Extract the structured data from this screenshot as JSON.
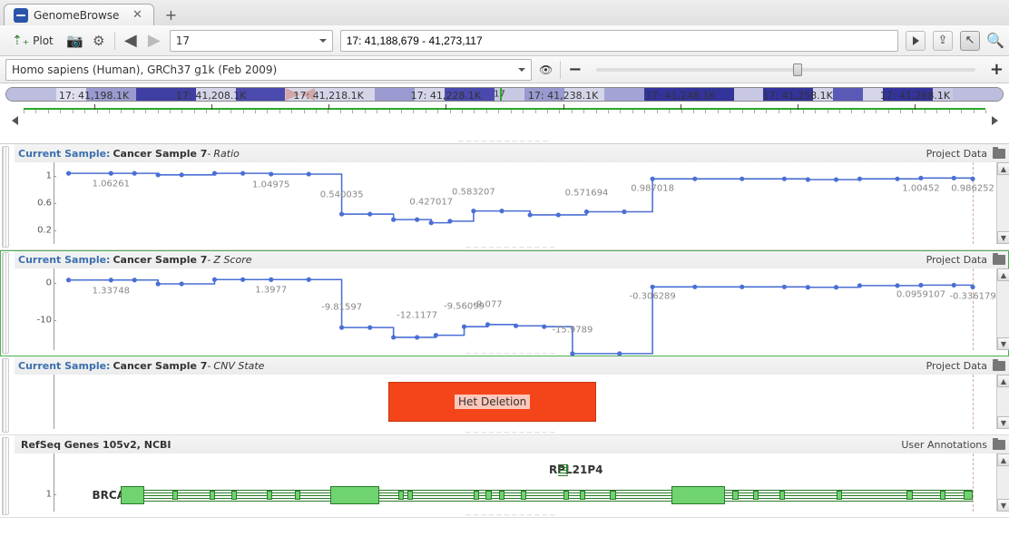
{
  "tab": {
    "title": "GenomeBrowse"
  },
  "toolbar": {
    "plot_label": "Plot",
    "chrom": "17",
    "location": "17: 41,188,679 - 41,273,117"
  },
  "species": {
    "label": "Homo sapiens (Human), GRCh37 g1k (Feb 2009)",
    "zoom_pos": 0.52
  },
  "ruler": {
    "ticks": [
      "17: 41,198.1K",
      "17: 41,208.1K",
      "17: 41,218.1K",
      "17: 41,228.1K",
      "17: 41,238.1K",
      "17: 41,248.1K",
      "17: 41,258.1K",
      "17: 41,268.1K"
    ]
  },
  "tracks": [
    {
      "id": "ratio",
      "prefix": "Current Sample:",
      "sample": "Cancer Sample 7",
      "metric": "Ratio",
      "right": "Project Data",
      "yticks": [
        "1",
        "0.6",
        "0.2"
      ],
      "points": [
        {
          "x": 0.015,
          "y": 1.06
        },
        {
          "x": 0.06,
          "y": 1.06,
          "l": "1.06261"
        },
        {
          "x": 0.085,
          "y": 1.06
        },
        {
          "x": 0.11,
          "y": 1.04
        },
        {
          "x": 0.135,
          "y": 1.04
        },
        {
          "x": 0.17,
          "y": 1.06
        },
        {
          "x": 0.2,
          "y": 1.06
        },
        {
          "x": 0.23,
          "y": 1.05,
          "l": "1.04975"
        },
        {
          "x": 0.27,
          "y": 1.05
        },
        {
          "x": 0.305,
          "y": 0.54,
          "l": "0.540035"
        },
        {
          "x": 0.335,
          "y": 0.54
        },
        {
          "x": 0.36,
          "y": 0.47
        },
        {
          "x": 0.385,
          "y": 0.47
        },
        {
          "x": 0.4,
          "y": 0.43,
          "l": "0.427017"
        },
        {
          "x": 0.42,
          "y": 0.45
        },
        {
          "x": 0.445,
          "y": 0.58,
          "l": "0.583207"
        },
        {
          "x": 0.475,
          "y": 0.58
        },
        {
          "x": 0.505,
          "y": 0.53
        },
        {
          "x": 0.535,
          "y": 0.53
        },
        {
          "x": 0.565,
          "y": 0.57,
          "l": "0.571694"
        },
        {
          "x": 0.605,
          "y": 0.57
        },
        {
          "x": 0.635,
          "y": 0.99,
          "l": "0.987018"
        },
        {
          "x": 0.68,
          "y": 0.99
        },
        {
          "x": 0.73,
          "y": 0.99
        },
        {
          "x": 0.775,
          "y": 0.99
        },
        {
          "x": 0.8,
          "y": 0.98
        },
        {
          "x": 0.83,
          "y": 0.98
        },
        {
          "x": 0.855,
          "y": 0.99
        },
        {
          "x": 0.895,
          "y": 0.99
        },
        {
          "x": 0.92,
          "y": 1.0,
          "l": "1.00452"
        },
        {
          "x": 0.955,
          "y": 1.0
        },
        {
          "x": 0.975,
          "y": 0.99,
          "l": "0.986252"
        }
      ],
      "ymin": 0,
      "ymax": 1.2
    },
    {
      "id": "zscore",
      "prefix": "Current Sample:",
      "sample": "Cancer Sample 7",
      "metric": "Z Score",
      "right": "Project Data",
      "yticks": [
        "0",
        "-10"
      ],
      "points": [
        {
          "x": 0.015,
          "y": 1.3
        },
        {
          "x": 0.06,
          "y": 1.3,
          "l": "1.33748"
        },
        {
          "x": 0.085,
          "y": 1.3
        },
        {
          "x": 0.11,
          "y": 0.4
        },
        {
          "x": 0.135,
          "y": 0.4
        },
        {
          "x": 0.17,
          "y": 1.4
        },
        {
          "x": 0.2,
          "y": 1.4
        },
        {
          "x": 0.23,
          "y": 1.4,
          "l": "1.3977"
        },
        {
          "x": 0.27,
          "y": 1.4
        },
        {
          "x": 0.305,
          "y": -9.8,
          "l": "-9.81597"
        },
        {
          "x": 0.335,
          "y": -9.8
        },
        {
          "x": 0.36,
          "y": -12.1
        },
        {
          "x": 0.385,
          "y": -12.1,
          "l": "-12.1177"
        },
        {
          "x": 0.405,
          "y": -11.6
        },
        {
          "x": 0.435,
          "y": -9.6,
          "l": "-9.56099"
        },
        {
          "x": 0.46,
          "y": -9.1,
          "l": "-9.077"
        },
        {
          "x": 0.49,
          "y": -9.4
        },
        {
          "x": 0.52,
          "y": -9.6
        },
        {
          "x": 0.55,
          "y": -15.9,
          "l": "-15.9789"
        },
        {
          "x": 0.6,
          "y": -15.9
        },
        {
          "x": 0.635,
          "y": -0.3,
          "l": "-0.306289"
        },
        {
          "x": 0.68,
          "y": -0.3
        },
        {
          "x": 0.73,
          "y": -0.3
        },
        {
          "x": 0.775,
          "y": -0.3
        },
        {
          "x": 0.8,
          "y": -0.4
        },
        {
          "x": 0.83,
          "y": -0.4
        },
        {
          "x": 0.855,
          "y": 0.0
        },
        {
          "x": 0.895,
          "y": 0.0
        },
        {
          "x": 0.92,
          "y": 0.1,
          "l": "0.0959107"
        },
        {
          "x": 0.955,
          "y": 0.1
        },
        {
          "x": 0.975,
          "y": -0.34,
          "l": "-0.336179"
        }
      ],
      "ymin": -18,
      "ymax": 4
    },
    {
      "id": "cnv",
      "prefix": "Current Sample:",
      "sample": "Cancer Sample 7",
      "metric": "CNV State",
      "right": "Project Data",
      "cnv": {
        "label": "Het Deletion",
        "x1": 0.355,
        "x2": 0.575
      }
    },
    {
      "id": "genes",
      "title": "RefSeq Genes 105v2, NCBI",
      "right": "User Annotations",
      "ylab": "1",
      "genes": [
        {
          "name": "RPL21P4",
          "x": 0.525,
          "lane": 0,
          "span": [
            0.535,
            0.545
          ]
        },
        {
          "name": "BRCA1",
          "x": 0.04,
          "lane": 1,
          "span": [
            0.07,
            0.975
          ],
          "exons": [
            [
              0.07,
              0.095,
              "big"
            ],
            [
              0.125,
              0.131
            ],
            [
              0.165,
              0.171
            ],
            [
              0.188,
              0.194
            ],
            [
              0.225,
              0.231
            ],
            [
              0.255,
              0.261
            ],
            [
              0.293,
              0.345,
              "big"
            ],
            [
              0.365,
              0.371
            ],
            [
              0.375,
              0.381
            ],
            [
              0.445,
              0.451
            ],
            [
              0.458,
              0.464
            ],
            [
              0.472,
              0.478
            ],
            [
              0.495,
              0.501
            ],
            [
              0.54,
              0.546
            ],
            [
              0.558,
              0.564
            ],
            [
              0.59,
              0.596
            ],
            [
              0.655,
              0.712,
              "big"
            ],
            [
              0.72,
              0.726
            ],
            [
              0.742,
              0.748
            ],
            [
              0.77,
              0.776
            ],
            [
              0.83,
              0.836
            ],
            [
              0.905,
              0.911
            ],
            [
              0.94,
              0.946
            ],
            [
              0.965,
              0.975
            ]
          ]
        }
      ]
    }
  ],
  "ideogram": {
    "indicator": 0.495,
    "label": "17",
    "bands": [
      {
        "x": 0.0,
        "w": 0.05,
        "c": "#bdbde0"
      },
      {
        "x": 0.05,
        "w": 0.03,
        "c": "#e0e0f0"
      },
      {
        "x": 0.08,
        "w": 0.05,
        "c": "#9a9ad0"
      },
      {
        "x": 0.13,
        "w": 0.06,
        "c": "#3f3fa3"
      },
      {
        "x": 0.19,
        "w": 0.04,
        "c": "#d5d5ea"
      },
      {
        "x": 0.23,
        "w": 0.05,
        "c": "#4a4aae"
      },
      {
        "x": 0.28,
        "w": 0.015,
        "c": "cen"
      },
      {
        "x": 0.295,
        "w": 0.015,
        "c": "cen2"
      },
      {
        "x": 0.31,
        "w": 0.06,
        "c": "#d5d5ea"
      },
      {
        "x": 0.37,
        "w": 0.04,
        "c": "#9a9ad0"
      },
      {
        "x": 0.41,
        "w": 0.03,
        "c": "#d5d5ea"
      },
      {
        "x": 0.44,
        "w": 0.05,
        "c": "#4a4aae"
      },
      {
        "x": 0.49,
        "w": 0.03,
        "c": "#c8c8e4"
      },
      {
        "x": 0.52,
        "w": 0.04,
        "c": "#9a9ad0"
      },
      {
        "x": 0.56,
        "w": 0.04,
        "c": "#d5d5ea"
      },
      {
        "x": 0.6,
        "w": 0.04,
        "c": "#a3a3d6"
      },
      {
        "x": 0.64,
        "w": 0.09,
        "c": "#33339c"
      },
      {
        "x": 0.73,
        "w": 0.03,
        "c": "#c8c8e4"
      },
      {
        "x": 0.76,
        "w": 0.05,
        "c": "#33339c"
      },
      {
        "x": 0.81,
        "w": 0.02,
        "c": "#d5d5ea"
      },
      {
        "x": 0.83,
        "w": 0.03,
        "c": "#5a5ab6"
      },
      {
        "x": 0.86,
        "w": 0.02,
        "c": "#d5d5ea"
      },
      {
        "x": 0.88,
        "w": 0.05,
        "c": "#33339c"
      },
      {
        "x": 0.93,
        "w": 0.02,
        "c": "#c8c8e4"
      },
      {
        "x": 0.95,
        "w": 0.05,
        "c": "#bdbde0"
      }
    ]
  }
}
